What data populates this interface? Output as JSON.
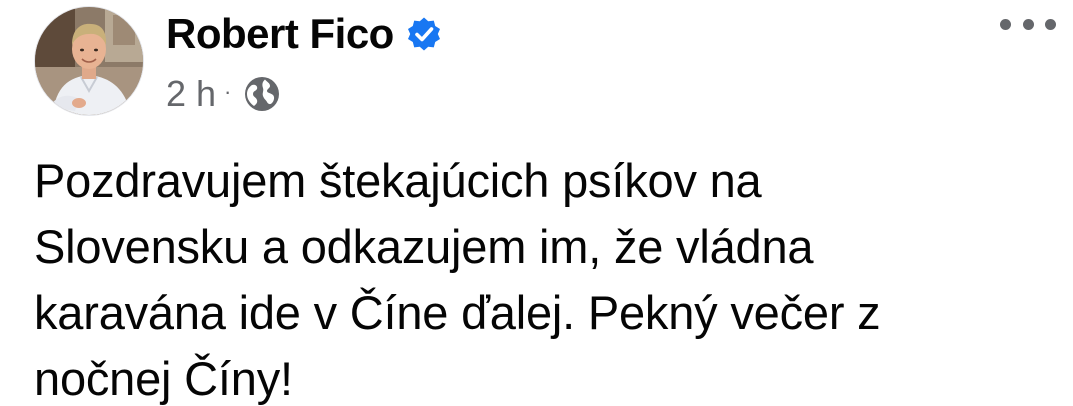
{
  "post": {
    "author_name": "Robert Fico",
    "verified_icon": "verified-badge-icon",
    "timestamp": "2 h",
    "separator": "·",
    "audience_icon": "globe-icon",
    "more_icon": "more-options-icon",
    "text": "Pozdravujem štekajúcich psíkov na\nSlovensku a odkazujem im, že vládna\nkaravána ide v Číne ďalej. Pekný večer z\nnočnej Číny!"
  },
  "colors": {
    "verified_badge": "#1877f2",
    "secondary_text": "#65676b",
    "primary_text": "#050505"
  }
}
